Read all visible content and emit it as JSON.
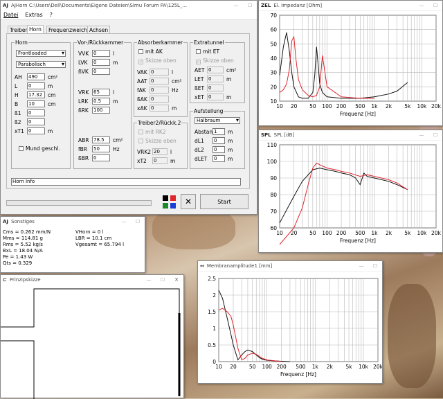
{
  "main": {
    "title": "AJHorn  C:\\Users\\Dell\\Documents\\Eigene Dateien\\Simu Forum PA\\125L_...",
    "menu": [
      "Datei",
      "Extras",
      "?"
    ],
    "tabs": [
      "Treiber",
      "Horn",
      "Frequenzweiche",
      "Achsen"
    ],
    "horn": {
      "label": "Horn",
      "type": "Frontloaded",
      "shape": "Parabolisch",
      "rows": [
        {
          "n": "AH",
          "v": "490",
          "u": "cm²"
        },
        {
          "n": "L",
          "v": "0",
          "u": "m"
        },
        {
          "n": "H",
          "v": "17.32",
          "u": "cm"
        },
        {
          "n": "B",
          "v": "10",
          "u": "cm"
        },
        {
          "n": "ß1",
          "v": "0",
          "u": ""
        },
        {
          "n": "ß2",
          "v": "0",
          "u": ""
        },
        {
          "n": "xT1",
          "v": "0",
          "u": "m"
        }
      ],
      "mund": "Mund geschl."
    },
    "vor": {
      "label": "Vor-/Rückkammer",
      "rows": [
        {
          "n": "VVK",
          "v": "0",
          "u": "l"
        },
        {
          "n": "LVK",
          "v": "0",
          "u": "m"
        },
        {
          "n": "ßVK",
          "v": "0",
          "u": ""
        },
        {
          "n": "VRK",
          "v": "65",
          "u": "l"
        },
        {
          "n": "LRK",
          "v": "0.5",
          "u": "m"
        },
        {
          "n": "ßRK",
          "v": "100",
          "u": ""
        },
        {
          "n": "ABR",
          "v": "78.5",
          "u": "cm²"
        },
        {
          "n": "fBR",
          "v": "50",
          "u": "Hz"
        },
        {
          "n": "ßBR",
          "v": "0",
          "u": ""
        }
      ]
    },
    "abs": {
      "label": "Absorberkammer",
      "mit": "mit AK",
      "skizze": "Skizze oben",
      "rows": [
        {
          "n": "VAK",
          "v": "0",
          "u": "l"
        },
        {
          "n": "AAT",
          "v": "0",
          "u": "cm²"
        },
        {
          "n": "fAK",
          "v": "0",
          "u": "Hz"
        },
        {
          "n": "ßAK",
          "v": "0",
          "u": ""
        },
        {
          "n": "xAK",
          "v": "0",
          "u": "m"
        }
      ]
    },
    "tr2": {
      "label": "Treiber2/Rückk.2",
      "mit": "mit RK2",
      "skizze": "Skizze oben",
      "rows": [
        {
          "n": "VRK2",
          "v": "20",
          "u": "l"
        },
        {
          "n": "xT2",
          "v": "0",
          "u": "m"
        }
      ]
    },
    "extra": {
      "label": "Extratunnel",
      "mit": "mit ET",
      "skizze": "Skizze oben",
      "rows": [
        {
          "n": "AET",
          "v": "0",
          "u": "cm²"
        },
        {
          "n": "LET",
          "v": "0",
          "u": "m"
        },
        {
          "n": "ßET",
          "v": "0",
          "u": ""
        },
        {
          "n": "xET",
          "v": "0",
          "u": "m"
        }
      ]
    },
    "auf": {
      "label": "Aufstellung",
      "raum": "Halbraum",
      "rows": [
        {
          "n": "Abstand",
          "v": "1",
          "u": "m"
        },
        {
          "n": "dL1",
          "v": "0",
          "u": "m"
        },
        {
          "n": "dL2",
          "v": "0",
          "u": "m"
        },
        {
          "n": "dLET",
          "v": "0",
          "u": "m"
        }
      ]
    },
    "info": "Horn Info",
    "start": "Start",
    "colors": {
      "red": "#e0252b",
      "blue": "#1a3fd6",
      "green": "#1a8a2a",
      "black": "#000000"
    }
  },
  "sonst": {
    "title": "Sonstiges",
    "left": [
      "Cms = 0.262 mm/N",
      "Mms = 114.81 g",
      "Rms = 5.52 kg/s",
      "BxL = 18.04 N/A",
      "Pe = 1.43 W",
      "Qts = 0.329"
    ],
    "right": [
      "VHorn = 0 l",
      "LBR = 10.1 cm",
      "Vgesamt = 65.794 l"
    ]
  },
  "skizze": {
    "title": "Prinzipskizze"
  },
  "imp": {
    "title": "El. Impedanz [Ohm]",
    "icon": "ZEL",
    "xlabel": "Frequenz [Hz]",
    "yticks": [
      "70",
      "60",
      "50",
      "40",
      "30",
      "20",
      "10"
    ],
    "xticks": [
      "10",
      "20",
      "50",
      "100",
      "200",
      "500",
      "1k",
      "2k",
      "5k",
      "10k",
      "20k"
    ]
  },
  "spl": {
    "title": "SPL [dB]",
    "icon": "SPL",
    "xlabel": "Frequenz [Hz]",
    "yticks": [
      "110",
      "100",
      "90",
      "80",
      "70",
      "60"
    ],
    "xticks": [
      "10",
      "20",
      "50",
      "100",
      "200",
      "500",
      "1k",
      "2k",
      "5k",
      "10k",
      "20k"
    ]
  },
  "mem": {
    "title": "Membranamplitude1 [mm]",
    "icon": "↔",
    "xlabel": "Frequenz [Hz]",
    "yticks": [
      "2.5",
      "2",
      "1.5",
      "1",
      "0.5",
      "0"
    ],
    "xticks": [
      "10",
      "20",
      "50",
      "100",
      "200",
      "500",
      "1k",
      "2k",
      "5k",
      "10k",
      "20k"
    ]
  },
  "chart_data": [
    {
      "type": "line",
      "title": "El. Impedanz [Ohm]",
      "xlabel": "Frequenz [Hz]",
      "xscale": "log",
      "xlim": [
        10,
        20000
      ],
      "ylim": [
        10,
        70
      ],
      "series": [
        {
          "color": "#111111",
          "x": [
            10,
            12,
            14,
            16,
            18,
            20,
            25,
            30,
            40,
            50,
            55,
            60,
            65,
            70,
            80,
            100,
            200,
            500,
            1000,
            2000,
            3000,
            5000
          ],
          "y": [
            28,
            48,
            58,
            45,
            30,
            20,
            13,
            12,
            12,
            16,
            28,
            48,
            35,
            22,
            16,
            13,
            12,
            12,
            13,
            15,
            17,
            23
          ]
        },
        {
          "color": "#e0252b",
          "x": [
            10,
            12,
            14,
            16,
            18,
            20,
            22,
            25,
            30,
            40,
            50,
            60,
            70,
            80,
            100,
            200,
            500,
            1000
          ],
          "y": [
            16,
            18,
            22,
            32,
            52,
            55,
            40,
            25,
            18,
            14,
            13,
            14,
            20,
            42,
            20,
            13,
            12,
            12
          ]
        }
      ]
    },
    {
      "type": "line",
      "title": "SPL [dB]",
      "xlabel": "Frequenz [Hz]",
      "xscale": "log",
      "xlim": [
        10,
        20000
      ],
      "ylim": [
        60,
        110
      ],
      "series": [
        {
          "color": "#111111",
          "x": [
            10,
            20,
            30,
            50,
            70,
            100,
            150,
            200,
            300,
            400,
            500,
            600,
            700,
            1000,
            2000,
            3000,
            5000
          ],
          "y": [
            63,
            79,
            88,
            95,
            96,
            95,
            94,
            93,
            92,
            90,
            86,
            93,
            91,
            90,
            88,
            86,
            83
          ]
        },
        {
          "color": "#e0252b",
          "x": [
            10,
            20,
            30,
            40,
            50,
            60,
            70,
            100,
            150,
            200,
            300,
            500,
            700,
            1000,
            2000,
            3000,
            5000
          ],
          "y": [
            50,
            60,
            72,
            86,
            96,
            99,
            98,
            96,
            95,
            94,
            93,
            91,
            92,
            91,
            89,
            87,
            83
          ]
        }
      ]
    },
    {
      "type": "line",
      "title": "Membranamplitude1 [mm]",
      "xlabel": "Frequenz [Hz]",
      "xscale": "log",
      "xlim": [
        10,
        20000
      ],
      "ylim": [
        0,
        2.5
      ],
      "series": [
        {
          "color": "#111111",
          "x": [
            10,
            12,
            15,
            18,
            20,
            25,
            30,
            35,
            40,
            50,
            60,
            70,
            80,
            100,
            150,
            200,
            300
          ],
          "y": [
            2.15,
            1.9,
            1.3,
            0.8,
            0.5,
            0.05,
            0.2,
            0.3,
            0.35,
            0.3,
            0.2,
            0.12,
            0.07,
            0.04,
            0.02,
            0.01,
            0
          ]
        },
        {
          "color": "#e0252b",
          "x": [
            10,
            12,
            15,
            18,
            20,
            22,
            25,
            30,
            35,
            40,
            50,
            60,
            70,
            80,
            100,
            150,
            200
          ],
          "y": [
            1.55,
            1.6,
            1.5,
            1.35,
            1.1,
            0.8,
            0.4,
            0.05,
            0.1,
            0.2,
            0.25,
            0.22,
            0.15,
            0.1,
            0.05,
            0.02,
            0
          ]
        }
      ]
    }
  ]
}
